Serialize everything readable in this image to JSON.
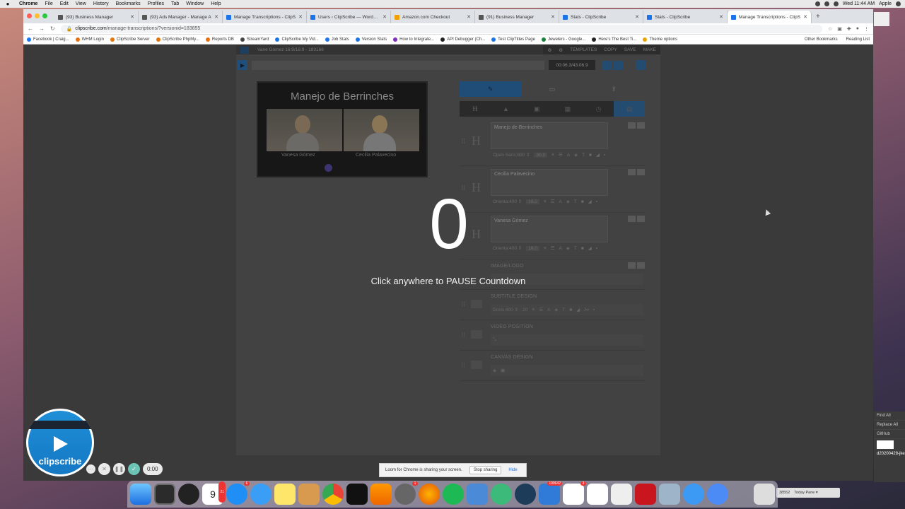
{
  "menubar": {
    "app": "Chrome",
    "items": [
      "File",
      "Edit",
      "View",
      "History",
      "Bookmarks",
      "Profiles",
      "Tab",
      "Window",
      "Help"
    ],
    "clock": "Wed 11:44 AM",
    "user": "Apple"
  },
  "tabs": [
    {
      "label": "(93) Business Manager",
      "active": false
    },
    {
      "label": "(93) Ads Manager - Manage A",
      "active": false
    },
    {
      "label": "Manage Transcriptions - ClipS",
      "active": false
    },
    {
      "label": "Users ‹ ClipScribe — WordPre",
      "active": false
    },
    {
      "label": "Amazon.com Checkout",
      "active": false
    },
    {
      "label": "(91) Business Manager",
      "active": false
    },
    {
      "label": "Stats - ClipScribe",
      "active": false
    },
    {
      "label": "Stats - ClipScribe",
      "active": false
    },
    {
      "label": "Manage Transcriptions - ClipS",
      "active": true
    }
  ],
  "address": {
    "host": "clipscribe.com",
    "path": "/manage-transcriptions/?versionid=183855"
  },
  "bookmarks": {
    "items": [
      "Facebook | Craig...",
      "WHM Login",
      "ClipScribe Server",
      "ClipScribe PhpMy...",
      "Reports DB",
      "StreamYard",
      "ClipScribe My Vid...",
      "Job Stats",
      "Version Stats",
      "How to Integrate...",
      "API Debugger (Ch...",
      "Test ClipTitles Page",
      "Jewelers - Google...",
      "Here's The Best Ti...",
      "Theme options"
    ],
    "other": "Other Bookmarks",
    "reading": "Reading List"
  },
  "app": {
    "project": "Vane Gómez 16:9/16:9 - 183166",
    "actions": [
      "TEMPLATES",
      "COPY",
      "SAVE",
      "MAKE"
    ],
    "timecode": "00:06.3/43:06.9",
    "preview": {
      "title": "Manejo de Berrinches",
      "left_name": "Vanesa Gómez",
      "right_name": "Cecilia Palavecino"
    },
    "layers": [
      {
        "text": "Manejo de Berrinches",
        "font": "Open Sans:600 ⇕",
        "size": "30.0"
      },
      {
        "text": "Cecilia Palavecino",
        "font": "Orienta:400 ⇕",
        "size": "16.0"
      },
      {
        "text": "Vanesa Gómez",
        "font": "Orienta:400 ⇕",
        "size": "16.0"
      }
    ],
    "sections": {
      "image_logo": "IMAGE/LOGO",
      "subtitle_design": "SUBTITLE DESIGN",
      "subtitle_font": "Dosis:400 ⇕",
      "subtitle_size": "20",
      "video_position": "VIDEO POSITION",
      "canvas_design": "CANVAS DESIGN"
    }
  },
  "overlay": {
    "countdown": "0",
    "hint": "Click anywhere to PAUSE Countdown"
  },
  "loom": {
    "brand": "clipscribe",
    "timer": "0:00",
    "sharing_text": "Loom for Chrome is sharing your screen.",
    "stop": "Stop sharing",
    "hide": "Hide"
  },
  "dock": {
    "calendar_month": "JUN",
    "calendar_day": "9",
    "badges": {
      "appstore": "6",
      "mail": "190642",
      "slack": "3",
      "system": "1",
      "calendar": "21"
    }
  },
  "rightwin": {
    "find_all": "Find All",
    "replace_all": "Replace All",
    "github": "GitHub",
    "file": "d20200428-jkex.pdf"
  },
  "taskbar_mini": {
    "left": "38552",
    "right": "Today Pane ▾"
  }
}
